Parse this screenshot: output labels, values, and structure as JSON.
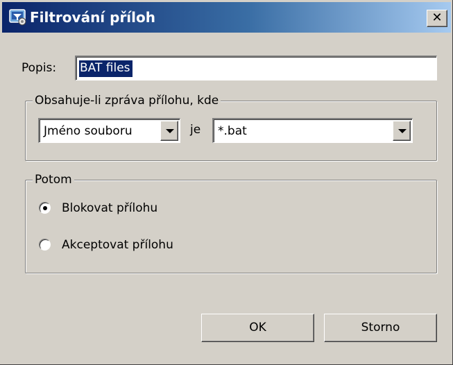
{
  "window": {
    "title": "Filtrování příloh",
    "close_label": "✕",
    "title_icon": "filter-app-icon"
  },
  "description": {
    "label": "Popis:",
    "value": "BAT files"
  },
  "condition_group": {
    "legend": "Obsahuje-li zpráva přílohu, kde",
    "field_select_value": "Jméno souboru",
    "operator_label": "je",
    "pattern_select_value": "*.bat"
  },
  "action_group": {
    "legend": "Potom",
    "options": [
      {
        "label": "Blokovat přílohu",
        "checked": true
      },
      {
        "label": "Akceptovat přílohu",
        "checked": false
      }
    ]
  },
  "buttons": {
    "ok_label": "OK",
    "cancel_label": "Storno"
  },
  "colors": {
    "titlebar_start": "#0a246a",
    "titlebar_end": "#a6caf0",
    "dialog_face": "#d4d0c8",
    "selection": "#0a246a"
  }
}
